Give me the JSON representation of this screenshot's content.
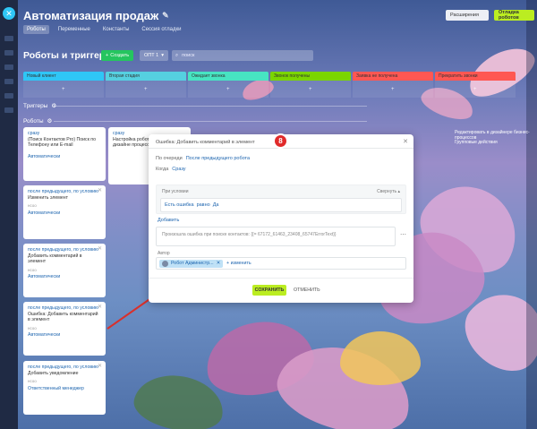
{
  "app": {
    "title": "Автоматизация продаж",
    "header_buttons": {
      "extend": "Расширения",
      "robot_sales": "Отладка роботов"
    },
    "tabs": [
      {
        "label": "Роботы",
        "active": true
      },
      {
        "label": "Переменные",
        "active": false
      },
      {
        "label": "Константы",
        "active": false
      },
      {
        "label": "Сессия отладки",
        "active": false
      }
    ]
  },
  "toolbar": {
    "heading": "Роботы и триггеры",
    "create_label": "Создать",
    "filter_label": "ОПТ 1",
    "search_placeholder": "поиск"
  },
  "stages": [
    {
      "label": "Новый клиент",
      "color": "#2fc6f6"
    },
    {
      "label": "Вторая стадия",
      "color": "#55d0e0"
    },
    {
      "label": "Ожидает звонка",
      "color": "#47e4c2"
    },
    {
      "label": "Звонок получены",
      "color": "#7bd500"
    },
    {
      "label": "Заявка не получена",
      "color": "#ff5752"
    },
    {
      "label": "Прекратить звонки",
      "color": "#ff5752"
    }
  ],
  "sections": {
    "triggers": "Триггеры",
    "robots": "Роботы"
  },
  "robot_cards": [
    {
      "cond": "сразу",
      "title": "(Поиск Контактов Pro) Поиск по Телефону или E-mail",
      "label": "",
      "link": "Автоматически",
      "foot_left": "",
      "foot_right": ""
    },
    {
      "cond": "после предыдущего, по условию",
      "title": "Изменить элемент",
      "label": "нсоо",
      "link": "Автоматически",
      "foot_left": "",
      "foot_right": ""
    },
    {
      "cond": "после предыдущего, по условию",
      "title": "Добавить комментарий в элемент",
      "label": "нсоо",
      "link": "Автоматически",
      "foot_left": "",
      "foot_right": ""
    },
    {
      "cond": "после предыдущего, по условию",
      "title": "Ошибка: Добавить комментарий в элемент",
      "label": "нсоо",
      "link": "Автоматически",
      "foot_left": "",
      "foot_right": ""
    },
    {
      "cond": "после предыдущего, по условию",
      "title": "Добавить уведомление",
      "label": "нсоо",
      "link": "Ответственный менеджер",
      "foot_left": "",
      "foot_right": ""
    }
  ],
  "second_card": {
    "cond": "сразу",
    "title": "Настройка робот только в дизайне процессов"
  },
  "right_texts": {
    "edit_hint": "Редактировать в дизайнере бизнес-процессов",
    "group_actions": "Групповые действия"
  },
  "dialog": {
    "title": "Ошибка: Добавить комментарий в элемент",
    "run_label": "По очереди",
    "run_value": "После предыдущего робота",
    "when_label": "Когда",
    "when_value": "Сразу",
    "conditions_label": "При условии",
    "collapse_label": "Свернуть",
    "condition_text": "Есть ошибка",
    "condition_op": "равно",
    "condition_value": "Да",
    "add_condition": "Добавить",
    "textarea_text": "Произошла ошибка при поиске контактов: {{= 67172_61463_23408_65747ErrorText}}",
    "author_label": "Автор",
    "author_name": "Робот Администр...",
    "author_change": "+ изменить",
    "save": "СОХРАНИТЬ",
    "cancel": "ОТМЕНИТЬ"
  },
  "step_badge": "8"
}
